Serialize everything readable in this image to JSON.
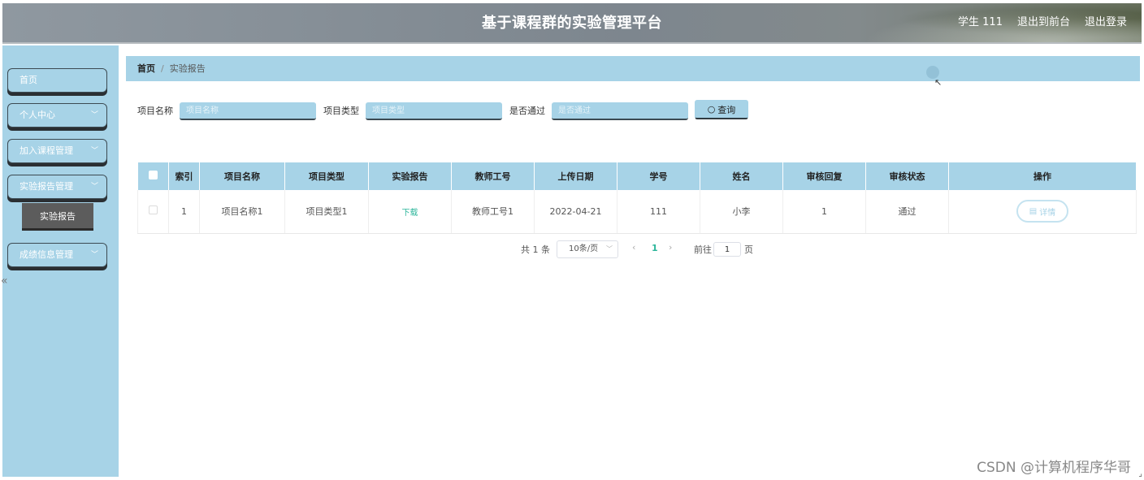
{
  "header": {
    "title": "基于课程群的实验管理平台",
    "user": "学生 111",
    "back_to_front": "退出到前台",
    "logout": "退出登录"
  },
  "sidebar": {
    "items": [
      {
        "label": "首页",
        "has_arrow": false
      },
      {
        "label": "个人中心",
        "has_arrow": true
      },
      {
        "label": "加入课程管理",
        "has_arrow": true
      },
      {
        "label": "实验报告管理",
        "has_arrow": true
      },
      {
        "label": "成绩信息管理",
        "has_arrow": true
      }
    ],
    "sub_item": "实验报告"
  },
  "breadcrumb": {
    "home": "首页",
    "current": "实验报告"
  },
  "search": {
    "fields": [
      {
        "label": "项目名称",
        "placeholder": "项目名称"
      },
      {
        "label": "项目类型",
        "placeholder": "项目类型"
      },
      {
        "label": "是否通过",
        "placeholder": "是否通过"
      }
    ],
    "button": "查询"
  },
  "table": {
    "columns": [
      "索引",
      "项目名称",
      "项目类型",
      "实验报告",
      "教师工号",
      "上传日期",
      "学号",
      "姓名",
      "审核回复",
      "审核状态",
      "操作"
    ],
    "rows": [
      {
        "index": "1",
        "project_name": "项目名称1",
        "project_type": "项目类型1",
        "report": "下载",
        "teacher_id": "教师工号1",
        "upload_date": "2022-04-21",
        "student_id": "111",
        "name": "小李",
        "review_reply": "1",
        "review_status": "通过",
        "action": "详情"
      }
    ]
  },
  "pagination": {
    "total": "共 1 条",
    "page_size": "10条/页",
    "current_page": "1",
    "goto_label": "前往",
    "goto_value": "1",
    "page_suffix": "页"
  },
  "watermark": "CSDN @计算机程序华哥",
  "colors": {
    "accent": "#a7d3e7",
    "link": "#2bb59a",
    "submenu": "#5c5c5c"
  }
}
